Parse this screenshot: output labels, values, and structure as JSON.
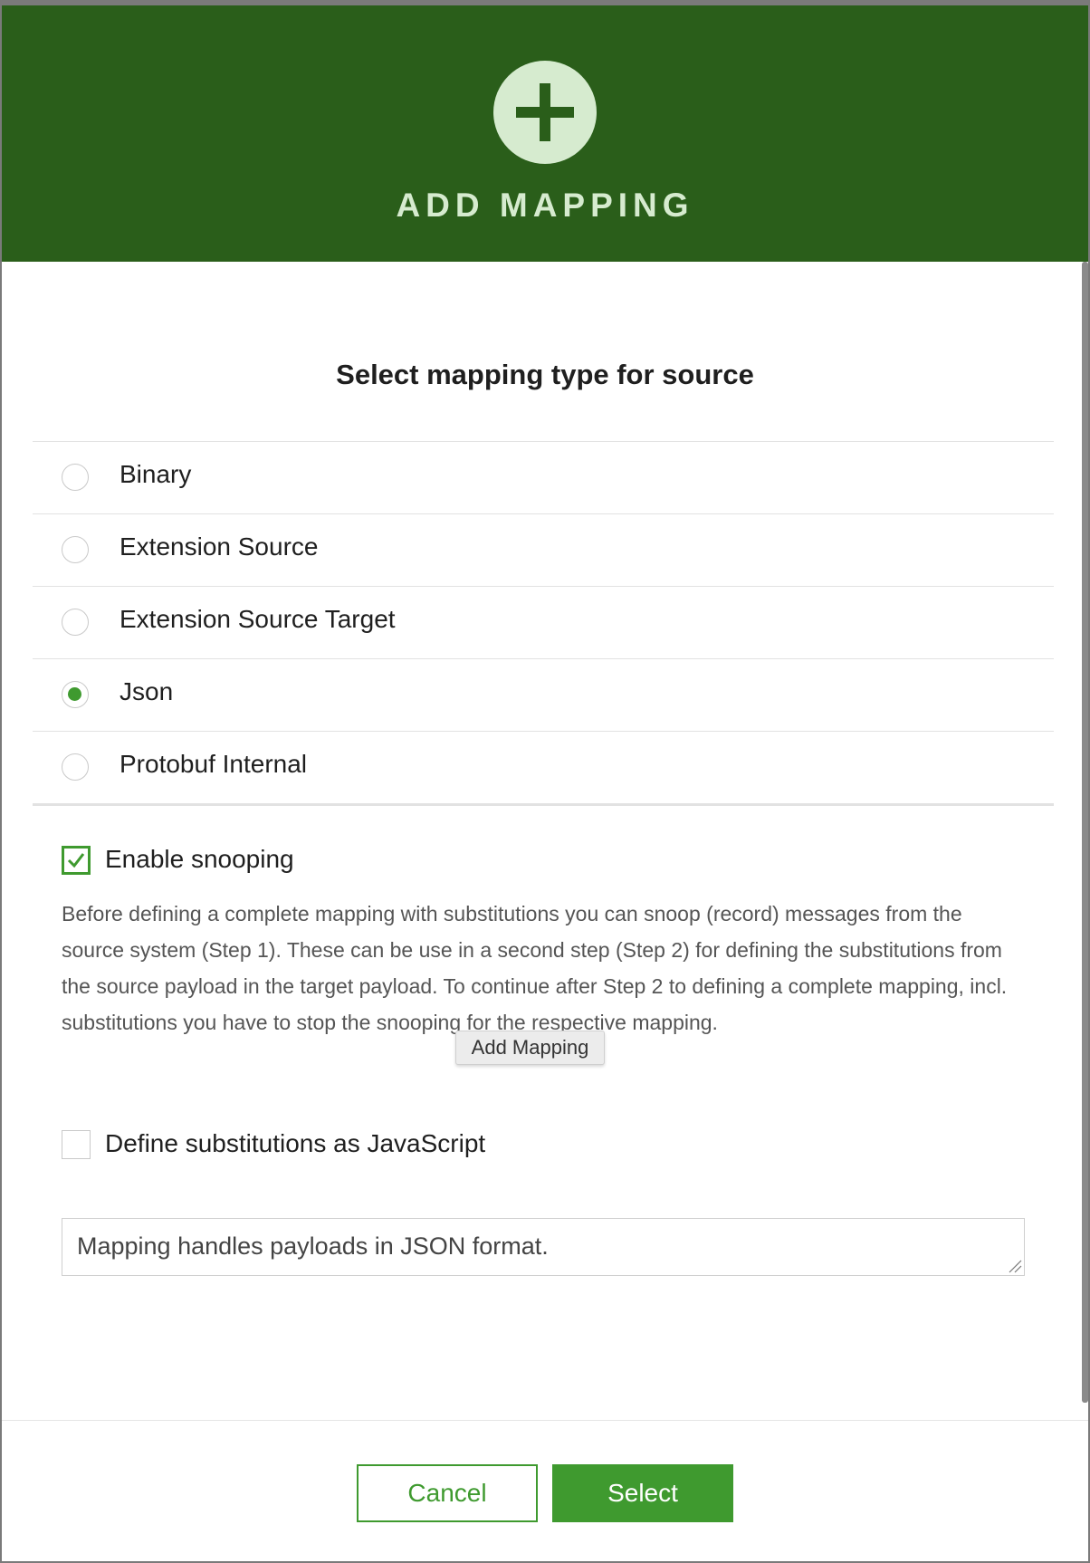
{
  "header": {
    "icon": "plus-icon",
    "title": "ADD MAPPING"
  },
  "section": {
    "title": "Select mapping type for source"
  },
  "mapping_types": [
    {
      "label": "Binary",
      "selected": false
    },
    {
      "label": "Extension Source",
      "selected": false
    },
    {
      "label": "Extension Source Target",
      "selected": false
    },
    {
      "label": "Json",
      "selected": true
    },
    {
      "label": "Protobuf Internal",
      "selected": false
    }
  ],
  "snooping": {
    "label": "Enable snooping",
    "checked": true,
    "help": "Before defining a complete mapping with substitutions you can snoop (record) messages from the source system (Step 1). These can be use in a second step (Step 2) for defining the substitutions from the source payload in the target payload. To continue after Step 2 to defining a complete mapping, incl. substitutions you have to stop the snooping for the respective mapping."
  },
  "tooltip": {
    "text": "Add Mapping"
  },
  "javascript": {
    "label": "Define substitutions as JavaScript",
    "checked": false
  },
  "description": {
    "value": "Mapping handles payloads in JSON format."
  },
  "footer": {
    "cancel_label": "Cancel",
    "select_label": "Select"
  },
  "colors": {
    "header_bg": "#2a5e1a",
    "header_accent": "#d6ebcf",
    "primary": "#3f9a2f"
  }
}
